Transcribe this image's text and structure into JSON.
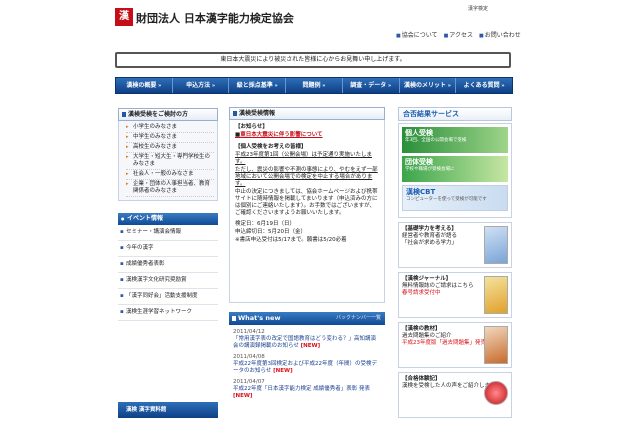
{
  "header": {
    "logo_mark": "漢検",
    "org_name": "財団法人 日本漢字能力検定協会",
    "top_link": "漢字検定",
    "nav": [
      "協会について",
      "アクセス",
      "お問い合わせ"
    ]
  },
  "notice": "東日本大震災により被災された皆様に心からお見舞い申し上げます。",
  "global_nav": [
    "漢検の概要",
    "申込方法",
    "級と採点基準",
    "問題例",
    "調査・データ",
    "漢検のメリット",
    "よくある質問"
  ],
  "left": {
    "who_title": "漢検受検をご検討の方",
    "who_items": [
      "小学生のみなさま",
      "中学生のみなさま",
      "高校生のみなさま",
      "大学生・短大生・専門学校生のみなさま",
      "社会人・一般のみなさま",
      "企業・団体の人事担当者、教育関係者のみなさま"
    ],
    "event_title": "イベント情報",
    "event_items": [
      "セミナー・講演会情報",
      "今年の漢字",
      "成績優秀者表彰",
      "漢検漢字文化研究奨励賞",
      "「漢字同好会」活動支援制度",
      "漢検生涯学習ネットワーク"
    ],
    "dict_bar": "漢検 漢字資料館"
  },
  "center": {
    "info_title": "漢検受検情報",
    "info_notice": "【お知らせ】",
    "info_link": "東日本大震災に伴う影響について",
    "info_sub": "【個人受検をお考えの皆様】",
    "info_p1": "平成23年度第1回（公開会場）は予定通り実施いたします。",
    "info_p2": "ただし、震災の影響や不測の事態により、やむをえず一部地域において公開会場での検定を中止する場合があります。",
    "info_p3": "中止の決定につきましては、協会ホームページおよび携帯サイトに随時情報を掲載してまいります（申込済みの方には個別にご連絡いたします）。お手数ではございますが、ご確認くださいますようお願いいたします。",
    "info_date1": "検定日：6月19日（日）",
    "info_date2": "申込締切日：5月20日（金）",
    "info_date3": "※書店申込受付は5/17まで。願書は5/20必着",
    "news_title": "What's new",
    "news_more": "バックナンバー一覧",
    "news": [
      {
        "date": "2011/04/12",
        "text": "「常用漢字表の改定で国語教育はどう変わる？」高知講演会の講演録掲載のお知らせ",
        "badge": "[NEW]"
      },
      {
        "date": "2011/04/08",
        "text": "平成22年度第3回検定および平成22年度（年間）の受検データのお知らせ",
        "badge": "[NEW]"
      },
      {
        "date": "2011/04/07",
        "text": "平成22年度「日本漢字能力検定 成績優秀者」表彰 発表",
        "badge": "[NEW]"
      }
    ]
  },
  "right": {
    "results_title": "合否結果サービス",
    "banners": [
      {
        "title": "個人受検",
        "sub": "年3回、全国の公開会場で受検"
      },
      {
        "title": "団体受検",
        "sub": "学校や職場が受検会場に"
      },
      {
        "title": "漢検CBT",
        "sub": "コンピューターを使って受検が可能です"
      }
    ],
    "boxes": [
      {
        "title": "【基礎学力を考える】",
        "lines": [
          "経営者や教育者が語る",
          "「社会が求める学力」"
        ],
        "red": ""
      },
      {
        "title": "【漢検ジャーナル】",
        "lines": [
          "無料情報誌のご請求はこちら"
        ],
        "red": "春号請求受付中"
      },
      {
        "title": "【漢検の教材】",
        "lines": [
          "過去問題集のご紹介"
        ],
        "red": "平成23年度版「過去問題集」発売中"
      },
      {
        "title": "【合格体験記】",
        "lines": [
          "漢検を受検した人の声をご紹介します"
        ],
        "red": ""
      }
    ]
  }
}
